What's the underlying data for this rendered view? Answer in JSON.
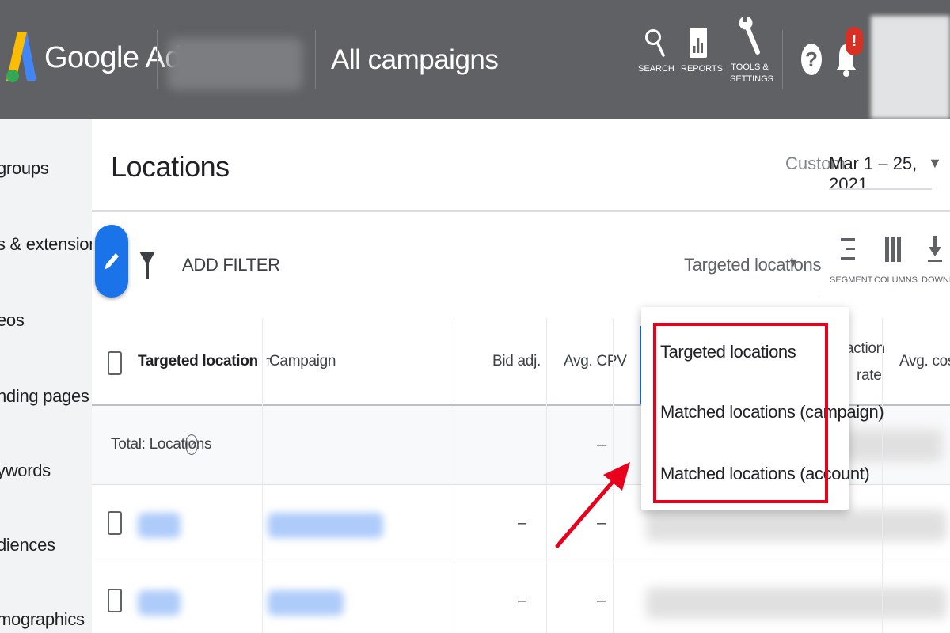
{
  "header": {
    "product_name": "Google Ads",
    "page_context": "All campaigns",
    "tools": [
      {
        "label": "SEARCH"
      },
      {
        "label": "REPORTS"
      },
      {
        "label": "TOOLS &",
        "label2": "SETTINGS"
      }
    ],
    "help_symbol": "?",
    "notification_badge": "!"
  },
  "nav": {
    "items": [
      {
        "label": "groups"
      },
      {
        "label": "s & extensions"
      },
      {
        "label": "eos"
      },
      {
        "label": "nding pages"
      },
      {
        "label": "ywords"
      },
      {
        "label": "diences"
      },
      {
        "label": "mographics"
      }
    ]
  },
  "page": {
    "title": "Locations",
    "date_label": "Custom",
    "date_range": "Mar 1 – 25, 2021"
  },
  "toolbar": {
    "add_filter": "ADD FILTER",
    "view_select": "Targeted locations",
    "tools": [
      {
        "label": "SEGMENT"
      },
      {
        "label": "COLUMNS"
      },
      {
        "label": "DOWNLO"
      }
    ]
  },
  "table": {
    "headers": {
      "targeted_location": "Targeted location",
      "campaign": "Campaign",
      "bid_adj": "Bid adj.",
      "avg_cpv": "Avg. CPV",
      "interaction_rate_1": "action",
      "interaction_rate_2": "rate",
      "avg_cost": "Avg. cost"
    },
    "total_label": "Total: Locations",
    "total_avg_cpv": "–",
    "rows": [
      {
        "bid_adj": "–",
        "avg_cpv": "–"
      },
      {
        "bid_adj": "–",
        "avg_cpv": "–"
      }
    ]
  },
  "menu": {
    "items": [
      {
        "label": "Targeted locations"
      },
      {
        "label": "Matched locations (campaign)"
      },
      {
        "label": "Matched locations (account)"
      }
    ]
  },
  "colors": {
    "topbar": "#5f6164",
    "accent_blue": "#1a73e8",
    "highlight_red": "#e8001c"
  }
}
